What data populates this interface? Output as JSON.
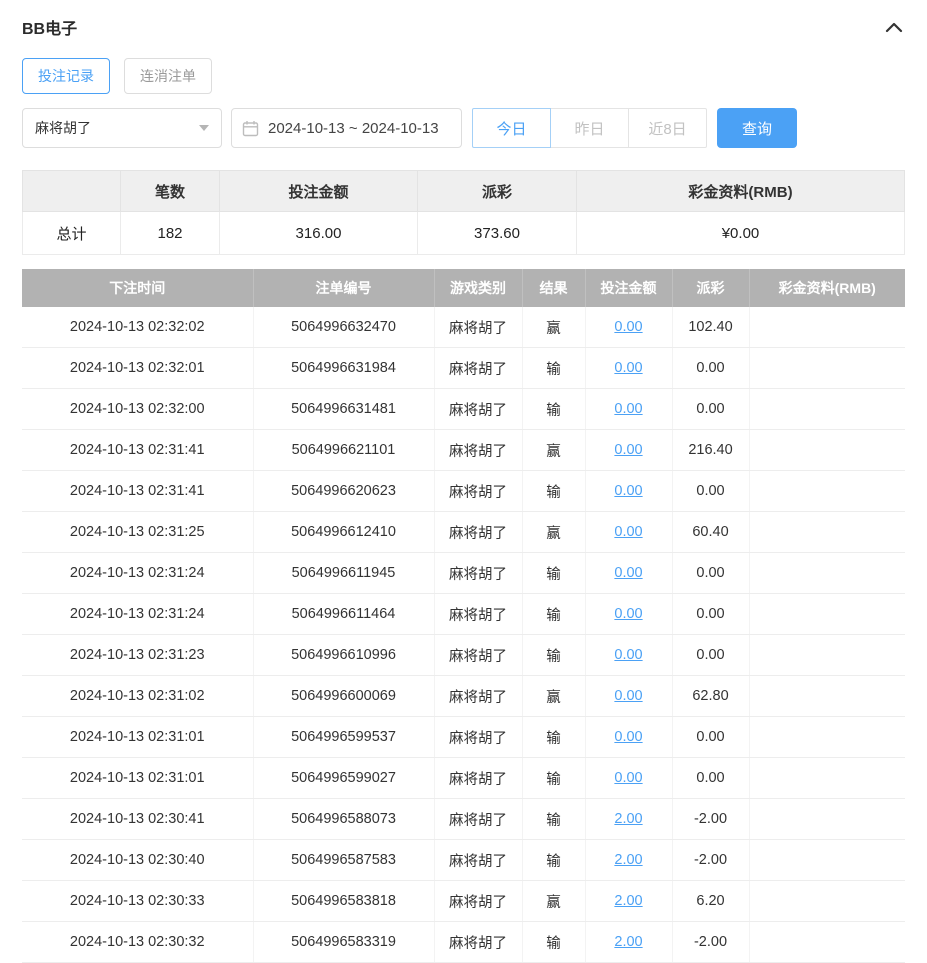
{
  "colors": {
    "accent": "#4ba1f5",
    "negative": "#fb5b5b",
    "table-header-bg": "#b2b2b2",
    "summary-header-bg": "#efefef"
  },
  "header": {
    "title": "BB电子",
    "collapse_icon": "chevron-up-icon"
  },
  "tabs": [
    {
      "label": "投注记录",
      "active": true
    },
    {
      "label": "连消注单",
      "active": false
    }
  ],
  "filters": {
    "game_select": {
      "value": "麻将胡了",
      "icon": "chevron-down-icon"
    },
    "date_range": {
      "value": "2024-10-13 ~ 2024-10-13",
      "icon": "calendar-icon"
    },
    "quick_buttons": [
      {
        "label": "今日",
        "active": true
      },
      {
        "label": "昨日",
        "active": false
      },
      {
        "label": "近8日",
        "active": false
      }
    ],
    "search_button": "查询"
  },
  "summary": {
    "columns": [
      "",
      "笔数",
      "投注金额",
      "派彩",
      "彩金资料(RMB)"
    ],
    "total": {
      "label": "总计",
      "count": "182",
      "bet_amount": "316.00",
      "payout": "373.60",
      "bonus": "¥0.00"
    }
  },
  "table": {
    "columns": [
      "下注时间",
      "注单编号",
      "游戏类别",
      "结果",
      "投注金额",
      "派彩",
      "彩金资料(RMB)"
    ],
    "rows": [
      {
        "time": "2024-10-13 02:32:02",
        "order_id": "5064996632470",
        "game": "麻将胡了",
        "result": "赢",
        "bet": "0.00",
        "payout": "102.40",
        "bonus": ""
      },
      {
        "time": "2024-10-13 02:32:01",
        "order_id": "5064996631984",
        "game": "麻将胡了",
        "result": "输",
        "bet": "0.00",
        "payout": "0.00",
        "bonus": ""
      },
      {
        "time": "2024-10-13 02:32:00",
        "order_id": "5064996631481",
        "game": "麻将胡了",
        "result": "输",
        "bet": "0.00",
        "payout": "0.00",
        "bonus": ""
      },
      {
        "time": "2024-10-13 02:31:41",
        "order_id": "5064996621101",
        "game": "麻将胡了",
        "result": "赢",
        "bet": "0.00",
        "payout": "216.40",
        "bonus": ""
      },
      {
        "time": "2024-10-13 02:31:41",
        "order_id": "5064996620623",
        "game": "麻将胡了",
        "result": "输",
        "bet": "0.00",
        "payout": "0.00",
        "bonus": ""
      },
      {
        "time": "2024-10-13 02:31:25",
        "order_id": "5064996612410",
        "game": "麻将胡了",
        "result": "赢",
        "bet": "0.00",
        "payout": "60.40",
        "bonus": ""
      },
      {
        "time": "2024-10-13 02:31:24",
        "order_id": "5064996611945",
        "game": "麻将胡了",
        "result": "输",
        "bet": "0.00",
        "payout": "0.00",
        "bonus": ""
      },
      {
        "time": "2024-10-13 02:31:24",
        "order_id": "5064996611464",
        "game": "麻将胡了",
        "result": "输",
        "bet": "0.00",
        "payout": "0.00",
        "bonus": ""
      },
      {
        "time": "2024-10-13 02:31:23",
        "order_id": "5064996610996",
        "game": "麻将胡了",
        "result": "输",
        "bet": "0.00",
        "payout": "0.00",
        "bonus": ""
      },
      {
        "time": "2024-10-13 02:31:02",
        "order_id": "5064996600069",
        "game": "麻将胡了",
        "result": "赢",
        "bet": "0.00",
        "payout": "62.80",
        "bonus": ""
      },
      {
        "time": "2024-10-13 02:31:01",
        "order_id": "5064996599537",
        "game": "麻将胡了",
        "result": "输",
        "bet": "0.00",
        "payout": "0.00",
        "bonus": ""
      },
      {
        "time": "2024-10-13 02:31:01",
        "order_id": "5064996599027",
        "game": "麻将胡了",
        "result": "输",
        "bet": "0.00",
        "payout": "0.00",
        "bonus": ""
      },
      {
        "time": "2024-10-13 02:30:41",
        "order_id": "5064996588073",
        "game": "麻将胡了",
        "result": "输",
        "bet": "2.00",
        "payout": "-2.00",
        "bonus": ""
      },
      {
        "time": "2024-10-13 02:30:40",
        "order_id": "5064996587583",
        "game": "麻将胡了",
        "result": "输",
        "bet": "2.00",
        "payout": "-2.00",
        "bonus": ""
      },
      {
        "time": "2024-10-13 02:30:33",
        "order_id": "5064996583818",
        "game": "麻将胡了",
        "result": "赢",
        "bet": "2.00",
        "payout": "6.20",
        "bonus": ""
      },
      {
        "time": "2024-10-13 02:30:32",
        "order_id": "5064996583319",
        "game": "麻将胡了",
        "result": "输",
        "bet": "2.00",
        "payout": "-2.00",
        "bonus": ""
      }
    ]
  }
}
